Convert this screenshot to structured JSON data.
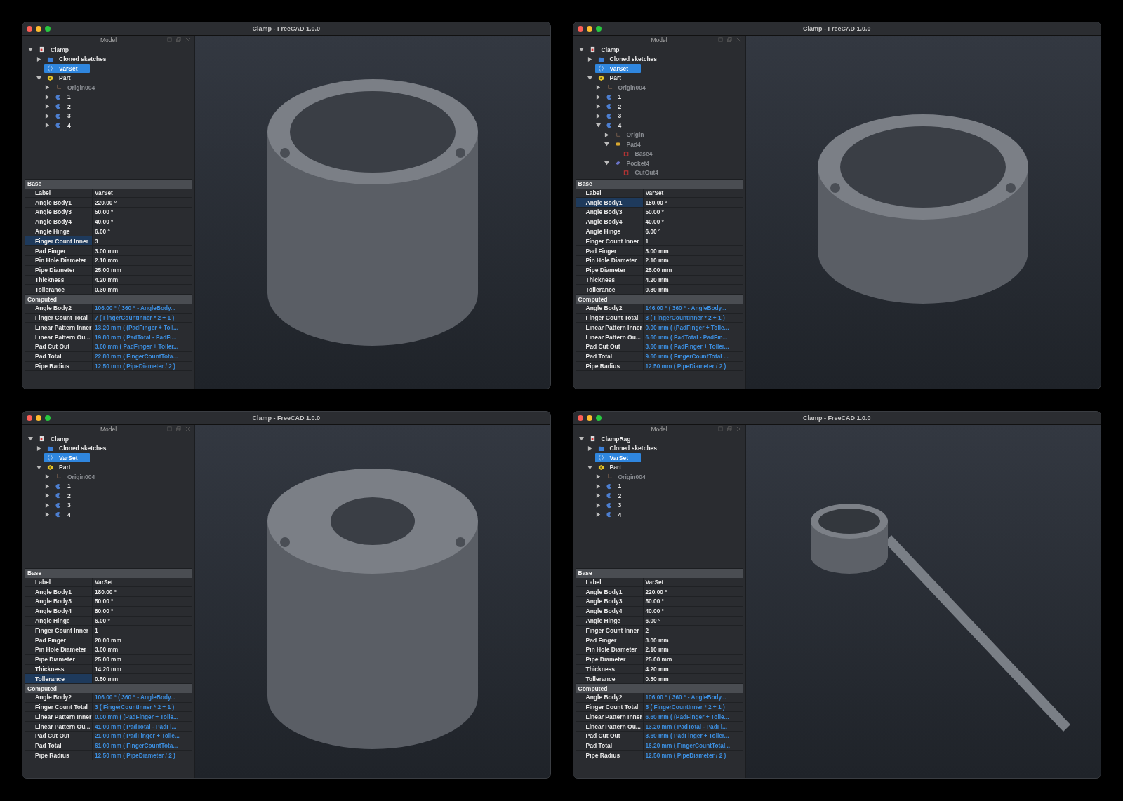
{
  "windows": [
    {
      "title": "Clamp - FreeCAD 1.0.0",
      "panel_title": "Model",
      "tree": [
        {
          "label": "Clamp",
          "kind": "document",
          "expanded": true,
          "selected": false,
          "hidden": false,
          "children": [
            {
              "label": "Cloned sketches",
              "kind": "folder",
              "expanded": false,
              "selected": false,
              "hidden": false
            },
            {
              "label": "VarSet",
              "kind": "varset",
              "selected": true,
              "hidden": false
            },
            {
              "label": "Part",
              "kind": "part",
              "expanded": true,
              "selected": false,
              "hidden": false,
              "children": [
                {
                  "label": "Origin004",
                  "kind": "origin",
                  "expanded": false,
                  "selected": false,
                  "hidden": true
                },
                {
                  "label": "1",
                  "kind": "body",
                  "expanded": false,
                  "selected": false,
                  "hidden": false
                },
                {
                  "label": "2",
                  "kind": "body",
                  "expanded": false,
                  "selected": false,
                  "hidden": false
                },
                {
                  "label": "3",
                  "kind": "body",
                  "expanded": false,
                  "selected": false,
                  "hidden": false
                },
                {
                  "label": "4",
                  "kind": "body",
                  "expanded": false,
                  "selected": false,
                  "hidden": false
                }
              ]
            }
          ]
        }
      ],
      "base_title": "Base",
      "base": [
        {
          "name": "Label",
          "value": "VarSet",
          "selected": false
        },
        {
          "name": "Angle Body1",
          "value": "220.00 °",
          "selected": false
        },
        {
          "name": "Angle Body3",
          "value": "50.00 °",
          "selected": false
        },
        {
          "name": "Angle Body4",
          "value": "40.00 °",
          "selected": false
        },
        {
          "name": "Angle Hinge",
          "value": "6.00 °",
          "selected": false
        },
        {
          "name": "Finger Count Inner",
          "value": "3",
          "selected": true
        },
        {
          "name": "Pad Finger",
          "value": "3.00 mm",
          "selected": false
        },
        {
          "name": "Pin Hole Diameter",
          "value": "2.10 mm",
          "selected": false
        },
        {
          "name": "Pipe Diameter",
          "value": "25.00 mm",
          "selected": false
        },
        {
          "name": "Thickness",
          "value": "4.20 mm",
          "selected": false
        },
        {
          "name": "Tollerance",
          "value": "0.30 mm",
          "selected": false
        }
      ],
      "computed_title": "Computed",
      "computed": [
        {
          "name": "Angle Body2",
          "value": "106.00 °  ( 360 ° - AngleBody..."
        },
        {
          "name": "Finger Count Total",
          "value": "7  ( FingerCountInner * 2 + 1 )"
        },
        {
          "name": "Linear Pattern Inner",
          "value": "13.20 mm  ( (PadFinger + Toll..."
        },
        {
          "name": "Linear Pattern Ou...",
          "value": "19.80 mm  ( PadTotal - PadFi..."
        },
        {
          "name": "Pad Cut Out",
          "value": "3.60 mm  ( PadFinger + Toller..."
        },
        {
          "name": "Pad Total",
          "value": "22.80 mm  ( FingerCountTota..."
        },
        {
          "name": "Pipe Radius",
          "value": "12.50 mm  ( PipeDiameter / 2 )"
        }
      ]
    },
    {
      "title": "Clamp - FreeCAD 1.0.0",
      "panel_title": "Model",
      "tree": [
        {
          "label": "Clamp",
          "kind": "document",
          "expanded": true,
          "selected": false,
          "hidden": false,
          "children": [
            {
              "label": "Cloned sketches",
              "kind": "folder",
              "expanded": false,
              "selected": false,
              "hidden": false
            },
            {
              "label": "VarSet",
              "kind": "varset",
              "selected": true,
              "hidden": false
            },
            {
              "label": "Part",
              "kind": "part",
              "expanded": true,
              "selected": false,
              "hidden": false,
              "children": [
                {
                  "label": "Origin004",
                  "kind": "origin",
                  "expanded": false,
                  "selected": false,
                  "hidden": true
                },
                {
                  "label": "1",
                  "kind": "body",
                  "expanded": false,
                  "selected": false,
                  "hidden": false
                },
                {
                  "label": "2",
                  "kind": "body",
                  "expanded": false,
                  "selected": false,
                  "hidden": false
                },
                {
                  "label": "3",
                  "kind": "body",
                  "expanded": false,
                  "selected": false,
                  "hidden": false
                },
                {
                  "label": "4",
                  "kind": "body",
                  "expanded": true,
                  "selected": false,
                  "hidden": false,
                  "children": [
                    {
                      "label": "Origin",
                      "kind": "origin",
                      "expanded": false,
                      "selected": false,
                      "hidden": true
                    },
                    {
                      "label": "Pad4",
                      "kind": "pad",
                      "expanded": true,
                      "selected": false,
                      "hidden": true,
                      "children": [
                        {
                          "label": "Base4",
                          "kind": "sketch",
                          "selected": false,
                          "hidden": true
                        }
                      ]
                    },
                    {
                      "label": "Pocket4",
                      "kind": "pocket",
                      "expanded": true,
                      "selected": false,
                      "hidden": true,
                      "children": [
                        {
                          "label": "CutOut4",
                          "kind": "sketch",
                          "selected": false,
                          "hidden": true
                        }
                      ]
                    }
                  ]
                }
              ]
            }
          ]
        }
      ],
      "base_title": "Base",
      "base": [
        {
          "name": "Label",
          "value": "VarSet",
          "selected": false
        },
        {
          "name": "Angle Body1",
          "value": "180.00 °",
          "selected": true
        },
        {
          "name": "Angle Body3",
          "value": "50.00 °",
          "selected": false
        },
        {
          "name": "Angle Body4",
          "value": "40.00 °",
          "selected": false
        },
        {
          "name": "Angle Hinge",
          "value": "6.00 °",
          "selected": false
        },
        {
          "name": "Finger Count Inner",
          "value": "1",
          "selected": false
        },
        {
          "name": "Pad Finger",
          "value": "3.00 mm",
          "selected": false
        },
        {
          "name": "Pin Hole Diameter",
          "value": "2.10 mm",
          "selected": false
        },
        {
          "name": "Pipe Diameter",
          "value": "25.00 mm",
          "selected": false
        },
        {
          "name": "Thickness",
          "value": "4.20 mm",
          "selected": false
        },
        {
          "name": "Tollerance",
          "value": "0.30 mm",
          "selected": false
        }
      ],
      "computed_title": "Computed",
      "computed": [
        {
          "name": "Angle Body2",
          "value": "146.00 °  ( 360 ° - AngleBody..."
        },
        {
          "name": "Finger Count Total",
          "value": "3  ( FingerCountInner * 2 + 1 )"
        },
        {
          "name": "Linear Pattern Inner",
          "value": "0.00 mm  ( (PadFinger + Tolle..."
        },
        {
          "name": "Linear Pattern Ou...",
          "value": "6.60 mm  ( PadTotal - PadFin..."
        },
        {
          "name": "Pad Cut Out",
          "value": "3.60 mm  ( PadFinger + Toller..."
        },
        {
          "name": "Pad Total",
          "value": "9.60 mm  ( FingerCountTotal ..."
        },
        {
          "name": "Pipe Radius",
          "value": "12.50 mm  ( PipeDiameter / 2 )"
        }
      ]
    },
    {
      "title": "Clamp - FreeCAD 1.0.0",
      "panel_title": "Model",
      "tree": [
        {
          "label": "Clamp",
          "kind": "document",
          "expanded": true,
          "selected": false,
          "hidden": false,
          "children": [
            {
              "label": "Cloned sketches",
              "kind": "folder",
              "expanded": false,
              "selected": false,
              "hidden": false
            },
            {
              "label": "VarSet",
              "kind": "varset",
              "selected": true,
              "hidden": false
            },
            {
              "label": "Part",
              "kind": "part",
              "expanded": true,
              "selected": false,
              "hidden": false,
              "children": [
                {
                  "label": "Origin004",
                  "kind": "origin",
                  "expanded": false,
                  "selected": false,
                  "hidden": true
                },
                {
                  "label": "1",
                  "kind": "body",
                  "expanded": false,
                  "selected": false,
                  "hidden": false
                },
                {
                  "label": "2",
                  "kind": "body",
                  "expanded": false,
                  "selected": false,
                  "hidden": false
                },
                {
                  "label": "3",
                  "kind": "body",
                  "expanded": false,
                  "selected": false,
                  "hidden": false
                },
                {
                  "label": "4",
                  "kind": "body",
                  "expanded": false,
                  "selected": false,
                  "hidden": false
                }
              ]
            }
          ]
        }
      ],
      "base_title": "Base",
      "base": [
        {
          "name": "Label",
          "value": "VarSet",
          "selected": false
        },
        {
          "name": "Angle Body1",
          "value": "180.00 °",
          "selected": false
        },
        {
          "name": "Angle Body3",
          "value": "50.00 °",
          "selected": false
        },
        {
          "name": "Angle Body4",
          "value": "80.00 °",
          "selected": false
        },
        {
          "name": "Angle Hinge",
          "value": "6.00 °",
          "selected": false
        },
        {
          "name": "Finger Count Inner",
          "value": "1",
          "selected": false
        },
        {
          "name": "Pad Finger",
          "value": "20.00 mm",
          "selected": false
        },
        {
          "name": "Pin Hole Diameter",
          "value": "3.00 mm",
          "selected": false
        },
        {
          "name": "Pipe Diameter",
          "value": "25.00 mm",
          "selected": false
        },
        {
          "name": "Thickness",
          "value": "14.20 mm",
          "selected": false
        },
        {
          "name": "Tollerance",
          "value": "0.50 mm",
          "selected": true
        }
      ],
      "computed_title": "Computed",
      "computed": [
        {
          "name": "Angle Body2",
          "value": "106.00 °  ( 360 ° - AngleBody..."
        },
        {
          "name": "Finger Count Total",
          "value": "3  ( FingerCountInner * 2 + 1 )"
        },
        {
          "name": "Linear Pattern Inner",
          "value": "0.00 mm  ( (PadFinger + Tolle..."
        },
        {
          "name": "Linear Pattern Ou...",
          "value": "41.00 mm  ( PadTotal - PadFi..."
        },
        {
          "name": "Pad Cut Out",
          "value": "21.00 mm  ( PadFinger + Tolle..."
        },
        {
          "name": "Pad Total",
          "value": "61.00 mm  ( FingerCountTota..."
        },
        {
          "name": "Pipe Radius",
          "value": "12.50 mm  ( PipeDiameter / 2 )"
        }
      ]
    },
    {
      "title": "Clamp - FreeCAD 1.0.0",
      "panel_title": "Model",
      "tree": [
        {
          "label": "ClampRag",
          "kind": "document",
          "expanded": true,
          "selected": false,
          "hidden": false,
          "children": [
            {
              "label": "Cloned sketches",
              "kind": "folder",
              "expanded": false,
              "selected": false,
              "hidden": false
            },
            {
              "label": "VarSet",
              "kind": "varset",
              "selected": true,
              "hidden": false
            },
            {
              "label": "Part",
              "kind": "part",
              "expanded": true,
              "selected": false,
              "hidden": false,
              "children": [
                {
                  "label": "Origin004",
                  "kind": "origin",
                  "expanded": false,
                  "selected": false,
                  "hidden": true
                },
                {
                  "label": "1",
                  "kind": "body",
                  "expanded": false,
                  "selected": false,
                  "hidden": false
                },
                {
                  "label": "2",
                  "kind": "body",
                  "expanded": false,
                  "selected": false,
                  "hidden": false
                },
                {
                  "label": "3",
                  "kind": "body",
                  "expanded": false,
                  "selected": false,
                  "hidden": false
                },
                {
                  "label": "4",
                  "kind": "body",
                  "expanded": false,
                  "selected": false,
                  "hidden": false
                }
              ]
            }
          ]
        }
      ],
      "base_title": "Base",
      "base": [
        {
          "name": "Label",
          "value": "VarSet",
          "selected": false
        },
        {
          "name": "Angle Body1",
          "value": "220.00 °",
          "selected": false
        },
        {
          "name": "Angle Body3",
          "value": "50.00 °",
          "selected": false
        },
        {
          "name": "Angle Body4",
          "value": "40.00 °",
          "selected": false
        },
        {
          "name": "Angle Hinge",
          "value": "6.00 °",
          "selected": false
        },
        {
          "name": "Finger Count Inner",
          "value": "2",
          "selected": false
        },
        {
          "name": "Pad Finger",
          "value": "3.00 mm",
          "selected": false
        },
        {
          "name": "Pin Hole Diameter",
          "value": "2.10 mm",
          "selected": false
        },
        {
          "name": "Pipe Diameter",
          "value": "25.00 mm",
          "selected": false
        },
        {
          "name": "Thickness",
          "value": "4.20 mm",
          "selected": false
        },
        {
          "name": "Tollerance",
          "value": "0.30 mm",
          "selected": false
        }
      ],
      "computed_title": "Computed",
      "computed": [
        {
          "name": "Angle Body2",
          "value": "106.00 °  ( 360 ° - AngleBody..."
        },
        {
          "name": "Finger Count Total",
          "value": "5  ( FingerCountInner * 2 + 1 )"
        },
        {
          "name": "Linear Pattern Inner",
          "value": "6.60 mm  ( (PadFinger + Tolle..."
        },
        {
          "name": "Linear Pattern Ou...",
          "value": "13.20 mm  ( PadTotal - PadFi..."
        },
        {
          "name": "Pad Cut Out",
          "value": "3.60 mm  ( PadFinger + Toller..."
        },
        {
          "name": "Pad Total",
          "value": "16.20 mm  ( FingerCountTotal..."
        },
        {
          "name": "Pipe Radius",
          "value": "12.50 mm  ( PipeDiameter / 2 )"
        }
      ]
    }
  ]
}
